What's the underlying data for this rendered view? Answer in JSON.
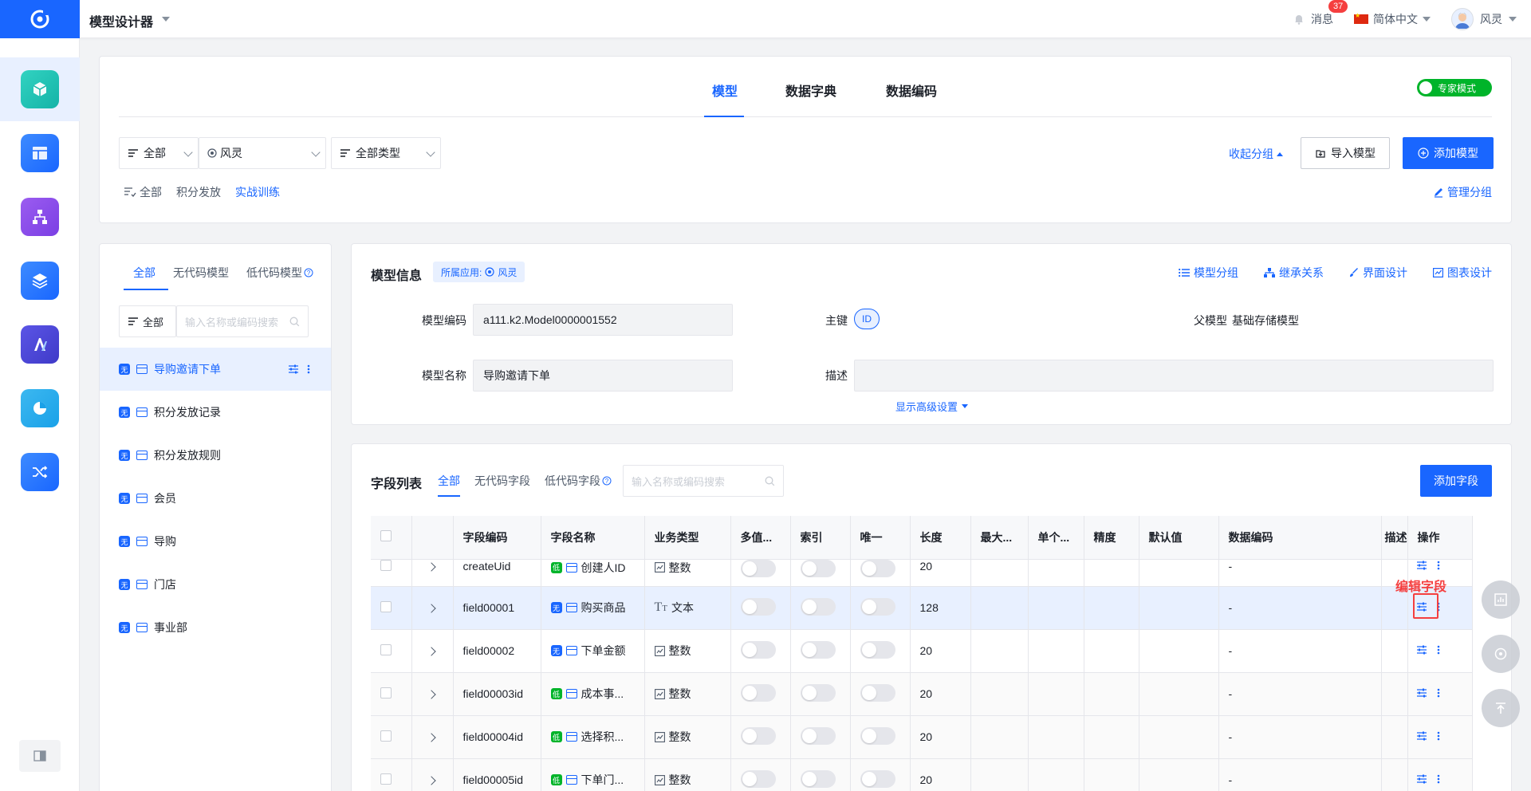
{
  "header": {
    "app_title": "模型设计器",
    "messages_label": "消息",
    "messages_count": "37",
    "language": "简体中文",
    "user_name": "风灵"
  },
  "sidebar": {
    "items": [
      "model",
      "layout",
      "flow",
      "layers",
      "ai",
      "chart",
      "shuffle"
    ],
    "colors": [
      "#23c4b1",
      "#1966ff",
      "#7b3fe4",
      "#1966ff",
      "#4a45d6",
      "#1aa1e8",
      "#1966ff"
    ]
  },
  "top": {
    "tabs": [
      "模型",
      "数据字典",
      "数据编码"
    ],
    "expert_mode": "专家模式",
    "filter_all": "全部",
    "filter_user": "风灵",
    "filter_type": "全部类型",
    "collapse_group": "收起分组",
    "import_model": "导入模型",
    "add_model": "添加模型",
    "groups": [
      "全部",
      "积分发放",
      "实战训练"
    ],
    "manage_group": "管理分组"
  },
  "model_list": {
    "tabs": [
      "全部",
      "无代码模型",
      "低代码模型"
    ],
    "filter_all": "全部",
    "search_placeholder": "输入名称或编码搜索",
    "items": [
      {
        "tag": "无",
        "name": "导购邀请下单"
      },
      {
        "tag": "无",
        "name": "积分发放记录"
      },
      {
        "tag": "无",
        "name": "积分发放规则"
      },
      {
        "tag": "无",
        "name": "会员"
      },
      {
        "tag": "无",
        "name": "导购"
      },
      {
        "tag": "无",
        "name": "门店"
      },
      {
        "tag": "无",
        "name": "事业部"
      }
    ]
  },
  "model_info": {
    "title": "模型信息",
    "app_label": "所属应用:",
    "app_name": "风灵",
    "actions": [
      "模型分组",
      "继承关系",
      "界面设计",
      "图表设计"
    ],
    "code_label": "模型编码",
    "code_value": "a111.k2.Model0000001552",
    "pk_label": "主键",
    "pk_value": "ID",
    "parent_label": "父模型",
    "parent_value": "基础存储模型",
    "name_label": "模型名称",
    "name_value": "导购邀请下单",
    "desc_label": "描述",
    "desc_value": "",
    "advanced": "显示高级设置"
  },
  "fields": {
    "title": "字段列表",
    "tabs": [
      "全部",
      "无代码字段",
      "低代码字段"
    ],
    "search_placeholder": "输入名称或编码搜索",
    "add_button": "添加字段",
    "columns": [
      "字段编码",
      "字段名称",
      "业务类型",
      "多值...",
      "索引",
      "唯一",
      "长度",
      "最大...",
      "单个...",
      "精度",
      "默认值",
      "数据编码",
      "描述",
      "操作"
    ],
    "rows": [
      {
        "code": "createUid",
        "tag": "低",
        "name": "创建人ID",
        "type": "整数",
        "length": "20",
        "encoding": "-"
      },
      {
        "code": "field00001",
        "tag": "无",
        "name": "购买商品",
        "type": "文本",
        "length": "128",
        "encoding": "-"
      },
      {
        "code": "field00002",
        "tag": "无",
        "name": "下单金额",
        "type": "整数",
        "length": "20",
        "encoding": "-"
      },
      {
        "code": "field00003id",
        "tag": "低",
        "name": "成本事...",
        "type": "整数",
        "length": "20",
        "encoding": "-"
      },
      {
        "code": "field00004id",
        "tag": "低",
        "name": "选择积...",
        "type": "整数",
        "length": "20",
        "encoding": "-"
      },
      {
        "code": "field00005id",
        "tag": "低",
        "name": "下单门...",
        "type": "整数",
        "length": "20",
        "encoding": "-"
      }
    ],
    "edit_field_label": "编辑字段"
  }
}
